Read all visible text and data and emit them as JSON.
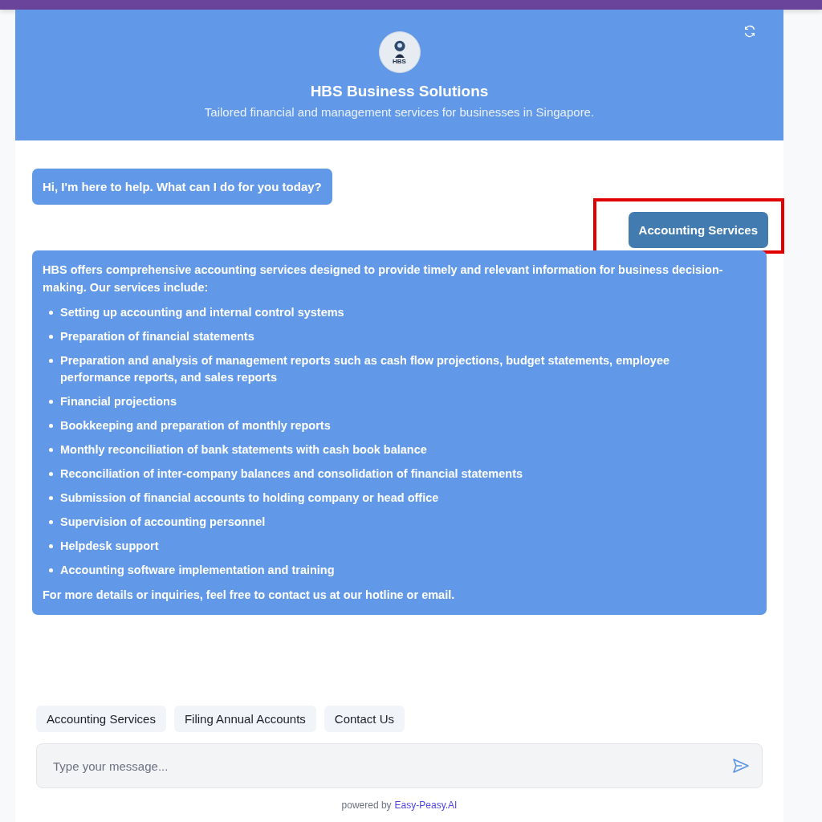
{
  "header": {
    "title": "HBS Business Solutions",
    "subtitle": "Tailored financial and management services for businesses in Singapore.",
    "logo_text": "HBS"
  },
  "messages": [
    {
      "kind": "bot",
      "text": "Hi, I'm here to help. What can I do for you today?"
    },
    {
      "kind": "user",
      "text": "Accounting Services",
      "highlighted": true
    },
    {
      "kind": "bot-list",
      "intro": "HBS offers comprehensive accounting services designed to provide timely and relevant information for business decision-making. Our services include:",
      "items": [
        "Setting up accounting and internal control systems",
        "Preparation of financial statements",
        "Preparation and analysis of management reports such as cash flow projections, budget statements, employee performance reports, and sales reports",
        "Financial projections",
        "Bookkeeping and preparation of monthly reports",
        "Monthly reconciliation of bank statements with cash book balance",
        "Reconciliation of inter-company balances and consolidation of financial statements",
        "Submission of financial accounts to holding company or head office",
        "Supervision of accounting personnel",
        "Helpdesk support",
        "Accounting software implementation and training"
      ],
      "outro": "For more details or inquiries, feel free to contact us at our hotline or email."
    }
  ],
  "quick_replies": [
    "Accounting Services",
    "Filing Annual Accounts",
    "Contact Us"
  ],
  "composer": {
    "placeholder": "Type your message..."
  },
  "footer": {
    "prefix": "powered by",
    "link": "Easy-Peasy.AI"
  }
}
